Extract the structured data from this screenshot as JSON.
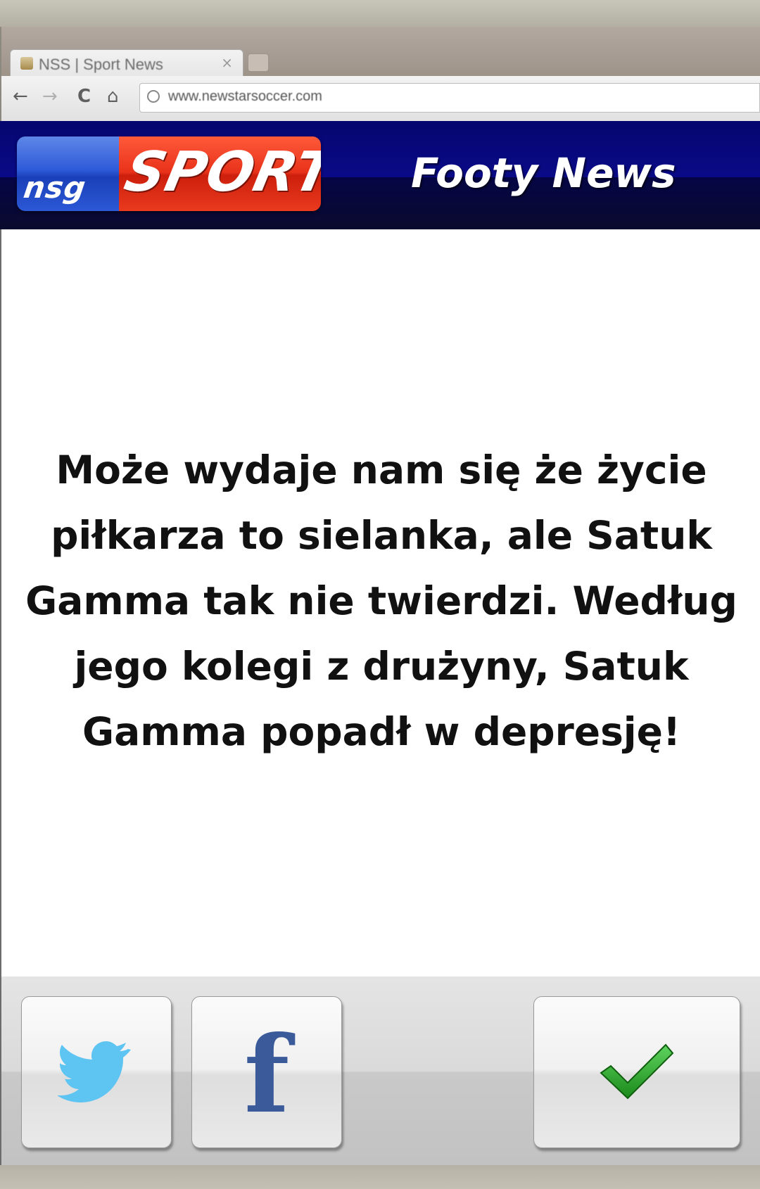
{
  "browser": {
    "tab_title": "NSS | Sport News",
    "tab_close": "×",
    "url": "www.newstarsoccer.com",
    "back_glyph": "←",
    "forward_glyph": "→",
    "reload_glyph": "C",
    "home_glyph": "⌂"
  },
  "header": {
    "logo_left": "nsg",
    "logo_right": "SPORT",
    "title": "Footy News"
  },
  "article": {
    "text": "Może wydaje nam się że życie piłkarza to sielanka, ale Satuk Gamma tak nie twierdzi. Według jego kolegi z drużyny, Satuk Gamma popadł w depresję!"
  },
  "actions": {
    "facebook_glyph": "f",
    "buttons": [
      {
        "icon": "twitter-bird-icon",
        "color": "#5ec4f2"
      },
      {
        "icon": "facebook-icon",
        "color": "#3b5a9a"
      },
      {
        "icon": "checkmark-icon",
        "color": "#2aa52a"
      }
    ]
  }
}
